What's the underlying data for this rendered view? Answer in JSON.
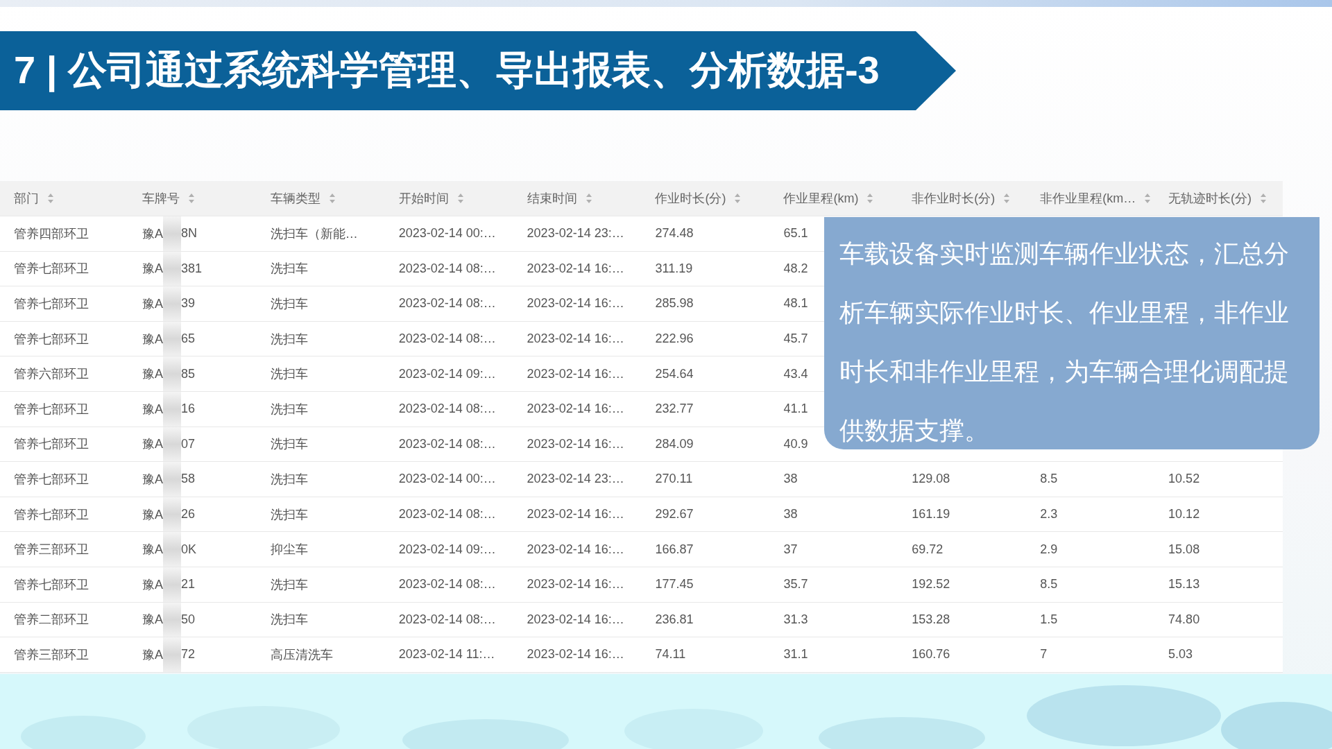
{
  "title": "7 | 公司通过系统科学管理、导出报表、分析数据-3",
  "table": {
    "columns": [
      "部门",
      "车牌号",
      "车辆类型",
      "开始时间",
      "结束时间",
      "作业时长(分)",
      "作业里程(km)",
      "非作业时长(分)",
      "非作业里程(km…",
      "无轨迹时长(分)"
    ],
    "rows": [
      {
        "cells": [
          "管养四部环卫",
          {
            "prefix": "豫A",
            "suffix": "8N"
          },
          "洗扫车（新能…",
          "2023-02-14 00:…",
          "2023-02-14 23:…",
          "274.48",
          "65.1",
          null,
          null,
          null
        ]
      },
      {
        "cells": [
          "管养七部环卫",
          {
            "prefix": "豫A",
            "suffix": "381"
          },
          "洗扫车",
          "2023-02-14 08:…",
          "2023-02-14 16:…",
          "311.19",
          "48.2",
          null,
          null,
          null
        ]
      },
      {
        "cells": [
          "管养七部环卫",
          {
            "prefix": "豫A",
            "suffix": "39"
          },
          "洗扫车",
          "2023-02-14 08:…",
          "2023-02-14 16:…",
          "285.98",
          "48.1",
          null,
          null,
          null
        ]
      },
      {
        "cells": [
          "管养七部环卫",
          {
            "prefix": "豫A",
            "suffix": "65"
          },
          "洗扫车",
          "2023-02-14 08:…",
          "2023-02-14 16:…",
          "222.96",
          "45.7",
          null,
          null,
          null
        ]
      },
      {
        "cells": [
          "管养六部环卫",
          {
            "prefix": "豫A",
            "suffix": "85"
          },
          "洗扫车",
          "2023-02-14 09:…",
          "2023-02-14 16:…",
          "254.64",
          "43.4",
          null,
          null,
          null
        ]
      },
      {
        "cells": [
          "管养七部环卫",
          {
            "prefix": "豫A",
            "suffix": "16"
          },
          "洗扫车",
          "2023-02-14 08:…",
          "2023-02-14 16:…",
          "232.77",
          "41.1",
          null,
          null,
          null
        ]
      },
      {
        "cells": [
          "管养七部环卫",
          {
            "prefix": "豫A",
            "suffix": "07"
          },
          "洗扫车",
          "2023-02-14 08:…",
          "2023-02-14 16:…",
          "284.09",
          "40.9",
          null,
          null,
          null
        ]
      },
      {
        "cells": [
          "管养七部环卫",
          {
            "prefix": "豫A",
            "suffix": "58"
          },
          "洗扫车",
          "2023-02-14 00:…",
          "2023-02-14 23:…",
          "270.11",
          "38",
          "129.08",
          "8.5",
          "10.52"
        ]
      },
      {
        "cells": [
          "管养七部环卫",
          {
            "prefix": "豫A",
            "suffix": "26"
          },
          "洗扫车",
          "2023-02-14 08:…",
          "2023-02-14 16:…",
          "292.67",
          "38",
          "161.19",
          "2.3",
          "10.12"
        ]
      },
      {
        "cells": [
          "管养三部环卫",
          {
            "prefix": "豫A",
            "suffix": "0K"
          },
          "抑尘车",
          "2023-02-14 09:…",
          "2023-02-14 16:…",
          "166.87",
          "37",
          "69.72",
          "2.9",
          "15.08"
        ]
      },
      {
        "cells": [
          "管养七部环卫",
          {
            "prefix": "豫A",
            "suffix": "21"
          },
          "洗扫车",
          "2023-02-14 08:…",
          "2023-02-14 16:…",
          "177.45",
          "35.7",
          "192.52",
          "8.5",
          "15.13"
        ]
      },
      {
        "cells": [
          "管养二部环卫",
          {
            "prefix": "豫A",
            "suffix": "50"
          },
          "洗扫车",
          "2023-02-14 08:…",
          "2023-02-14 16:…",
          "236.81",
          "31.3",
          "153.28",
          "1.5",
          "74.80"
        ]
      },
      {
        "cells": [
          "管养三部环卫",
          {
            "prefix": "豫A",
            "suffix": "72"
          },
          "高压清洗车",
          "2023-02-14 11:…",
          "2023-02-14 16:…",
          "74.11",
          "31.1",
          "160.76",
          "7",
          "5.03"
        ]
      }
    ]
  },
  "callout": "车载设备实时监测车辆作业状态，汇总分析车辆实际作业时长、作业里程，非作业时长和非作业里程，为车辆合理化调配提供数据支撑。"
}
